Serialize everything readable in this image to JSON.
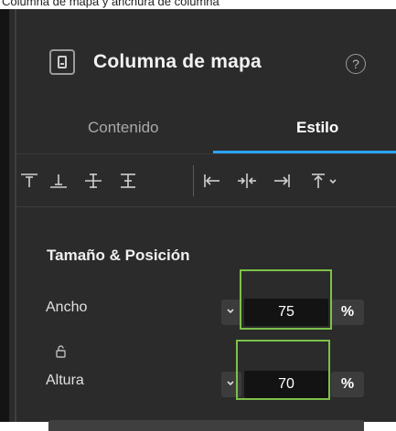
{
  "caption": "Columna de mapa y anchura de columna",
  "header": {
    "title": "Columna de mapa",
    "help_glyph": "?",
    "widget_icon": "map-column-widget-icon",
    "help_icon": "help-circle-icon"
  },
  "tabs": [
    {
      "label": "Contenido",
      "active": false
    },
    {
      "label": "Estilo",
      "active": true
    }
  ],
  "toolbar": {
    "icons": [
      "align-top-icon",
      "align-bottom-icon",
      "align-middle-icon",
      "distribute-vertical-icon",
      "align-left-icon",
      "align-center-horizontal-icon",
      "align-right-icon",
      "align-top-dropdown-icon"
    ]
  },
  "section": {
    "title": "Tamaño & Posición",
    "width": {
      "label": "Ancho",
      "value": "75",
      "unit": "%"
    },
    "height": {
      "label": "Altura",
      "value": "70",
      "unit": "%"
    },
    "lock_icon": "unlock-aspect-ratio-icon"
  },
  "colors": {
    "panel_bg": "#2b2b2b",
    "input_bg": "#131313",
    "active_tab_underline": "#2aa4ff",
    "highlight": "#7dc04a"
  }
}
